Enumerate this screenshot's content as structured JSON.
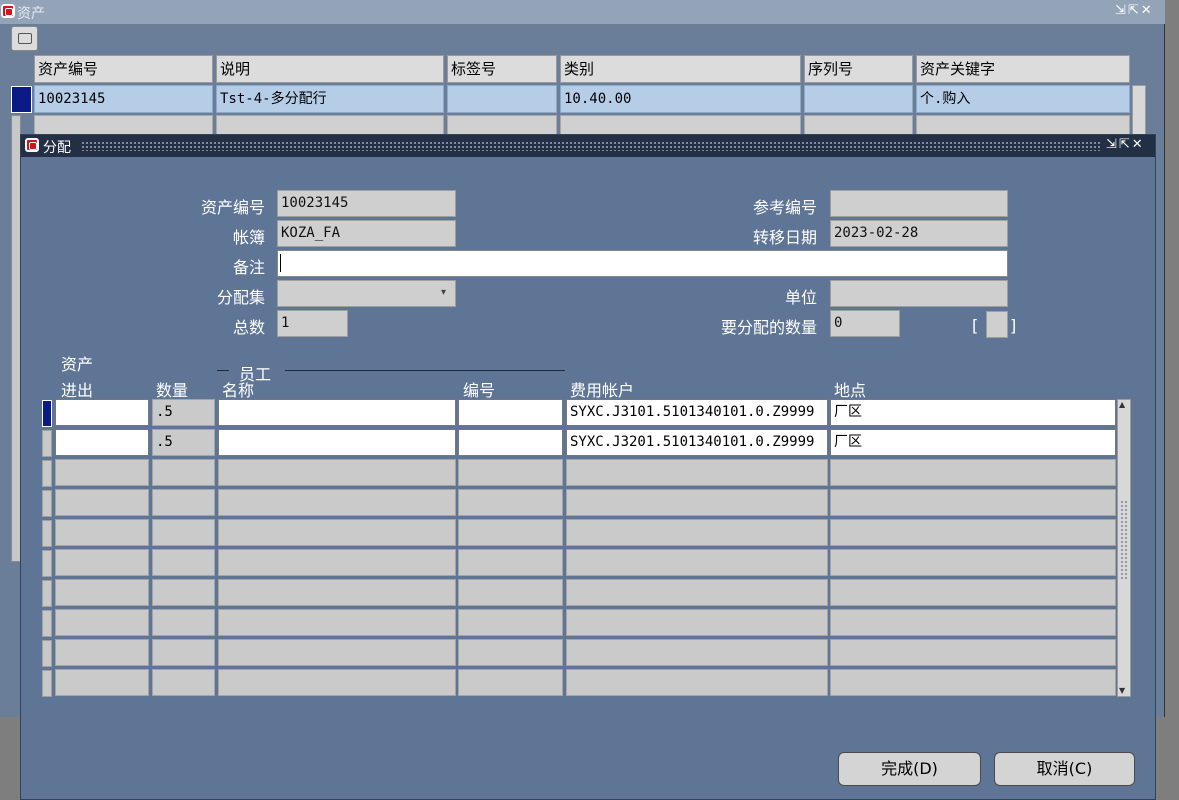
{
  "bg_window": {
    "title": "资产",
    "controls": "⇲⇱✕",
    "columns": [
      "资产编号",
      "说明",
      "标签号",
      "类别",
      "序列号",
      "资产关键字"
    ],
    "row": [
      "10023145",
      "Tst-4-多分配行",
      "",
      "10.40.00",
      "",
      "个.购入"
    ]
  },
  "dialog": {
    "title": "分配",
    "controls": "⇲⇱✕",
    "fields": {
      "asset_no_label": "资产编号",
      "asset_no": "10023145",
      "book_label": "帐簿",
      "book": "KOZA_FA",
      "note_label": "备注",
      "note": "",
      "dist_set_label": "分配集",
      "dist_set": "",
      "total_label": "总数",
      "total": "1",
      "ref_no_label": "参考编号",
      "ref_no": "",
      "transfer_date_label": "转移日期",
      "transfer_date": "2023-02-28",
      "unit_label": "单位",
      "unit": "",
      "to_distribute_label": "要分配的数量",
      "to_distribute": "0",
      "bracket_open": "[",
      "bracket_close": "]"
    },
    "grid": {
      "group_asset": "资产",
      "group_employee": "员工",
      "headers": {
        "in_out": "进出",
        "qty": "数量",
        "name": "名称",
        "number": "编号",
        "expense_account": "费用帐户",
        "location": "地点"
      },
      "rows": [
        {
          "in_out": "",
          "qty": ".5",
          "name": "",
          "number": "",
          "expense_account": "SYXC.J3101.5101340101.0.Z9999",
          "location": "厂区"
        },
        {
          "in_out": "",
          "qty": ".5",
          "name": "",
          "number": "",
          "expense_account": "SYXC.J3201.5101340101.0.Z9999",
          "location": "厂区"
        }
      ]
    },
    "buttons": {
      "done": "完成(D)",
      "cancel": "取消(C)"
    }
  },
  "colors": {
    "dialog_bg": "#5f7596",
    "title_active": "#232f44",
    "selected_row": "#b6cde8",
    "oracle_red": "#d2141c"
  }
}
